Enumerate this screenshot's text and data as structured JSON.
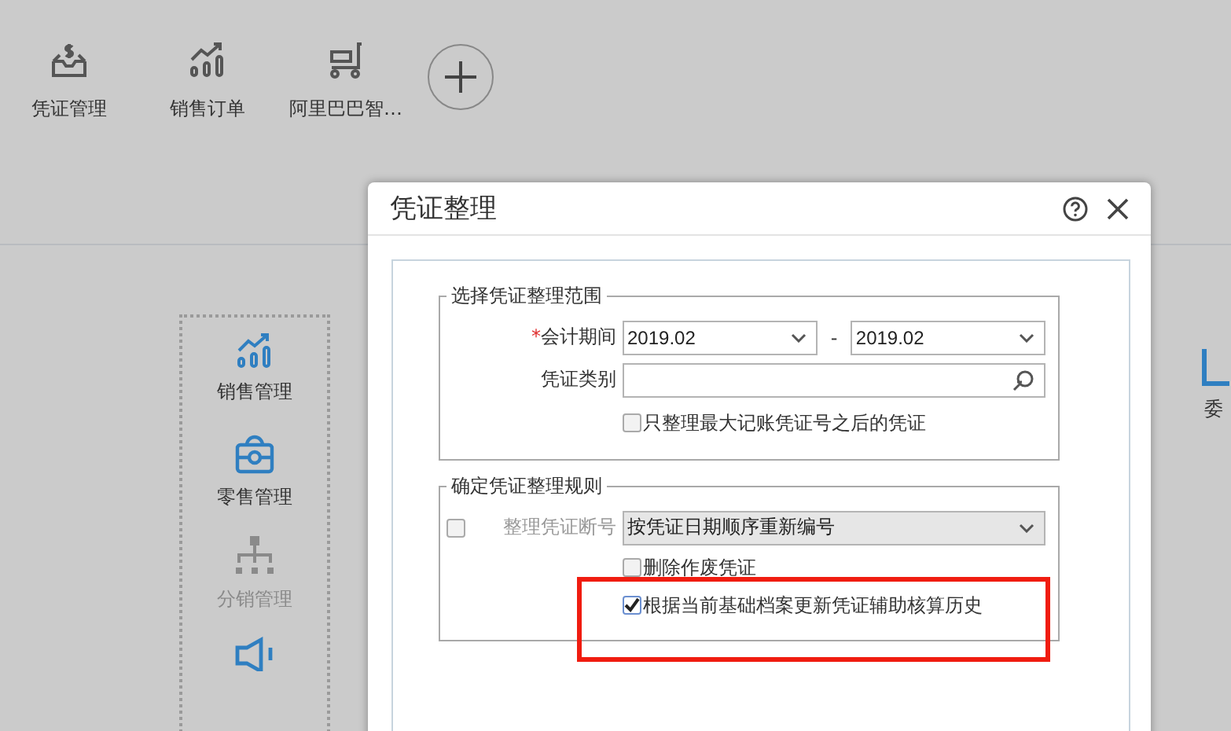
{
  "toolbar": {
    "items": [
      {
        "label": "凭证管理",
        "kind": "inbox"
      },
      {
        "label": "销售订单",
        "kind": "chart"
      },
      {
        "label": "阿里巴巴智…",
        "kind": "cart"
      }
    ]
  },
  "modules": {
    "items": [
      {
        "label": "销售管理",
        "kind": "chart",
        "disabled": false
      },
      {
        "label": "零售管理",
        "kind": "bag",
        "disabled": false
      },
      {
        "label": "分销管理",
        "kind": "org",
        "disabled": true
      },
      {
        "kind": "speaker",
        "disabled": false
      }
    ]
  },
  "side_module": {
    "label": "委",
    "kind": "report"
  },
  "dialog": {
    "title": "凭证整理",
    "range_section": {
      "legend": "选择凭证整理范围",
      "period": {
        "label": "会计期间",
        "required": true,
        "required_mark": "*",
        "from": "2019.02",
        "separator": "-",
        "to": "2019.02"
      },
      "voucher_type": {
        "label": "凭证类别"
      },
      "only_after_max": {
        "label": "只整理最大记账凭证号之后的凭证",
        "checked": false
      }
    },
    "rule_section": {
      "legend": "确定凭证整理规则",
      "renumber": {
        "label": "整理凭证断号",
        "checked": false,
        "disabled": true,
        "value": "按凭证日期顺序重新编号"
      },
      "delete_void": {
        "label": "删除作废凭证",
        "checked": false
      },
      "update_history": {
        "label": "根据当前基础档案更新凭证辅助核算历史",
        "checked": true,
        "highlighted": true
      }
    }
  }
}
